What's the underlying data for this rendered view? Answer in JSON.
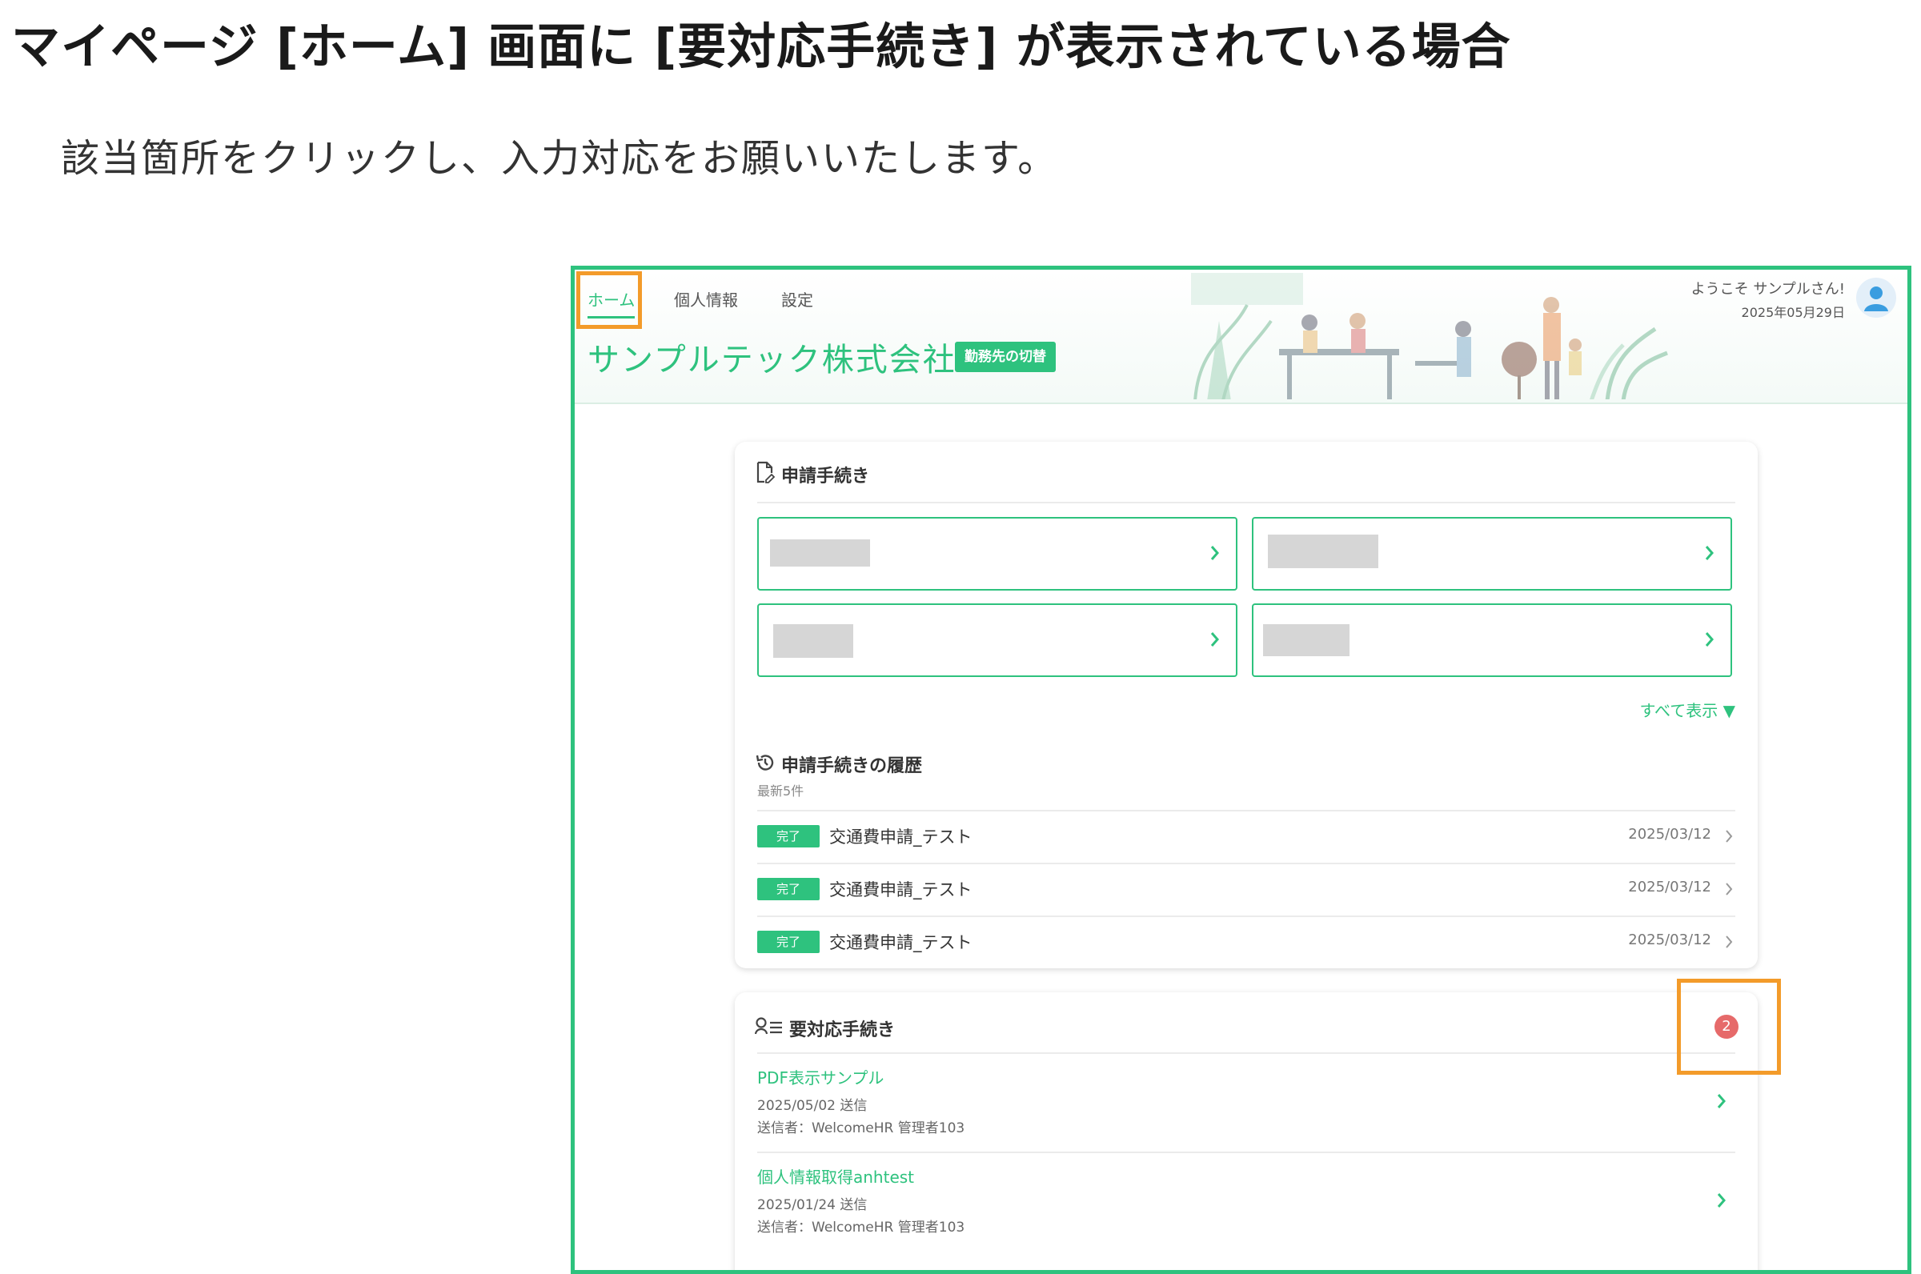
{
  "document": {
    "title": "マイページ [ホーム] 画面に [要対応手続き] が表示されている場合",
    "instruction": "該当箇所をクリックし、入力対応をお願いいたします。"
  },
  "nav": {
    "tabs": [
      {
        "label": "ホーム"
      },
      {
        "label": "個人情報"
      },
      {
        "label": "設定"
      }
    ]
  },
  "header": {
    "company": "サンプルテック株式会社",
    "switch_label": "勤務先の切替",
    "welcome": "ようこそ サンプルさん!",
    "date": "2025年05月29日"
  },
  "applications": {
    "title": "申請手続き",
    "show_all": "すべて表示 ▼"
  },
  "history": {
    "title": "申請手続きの履歴",
    "subtitle": "最新5件",
    "rows": [
      {
        "status": "完了",
        "name": "交通費申請_テスト",
        "date": "2025/03/12"
      },
      {
        "status": "完了",
        "name": "交通費申請_テスト",
        "date": "2025/03/12"
      },
      {
        "status": "完了",
        "name": "交通費申請_テスト",
        "date": "2025/03/12"
      }
    ]
  },
  "actions": {
    "title": "要対応手続き",
    "count": "2",
    "items": [
      {
        "name": "PDF表示サンプル",
        "date": "2025/05/02 送信",
        "sender": "送信者：WelcomeHR 管理者103"
      },
      {
        "name": "個人情報取得anhtest",
        "date": "2025/01/24 送信",
        "sender": "送信者：WelcomeHR 管理者103"
      }
    ]
  },
  "colors": {
    "accent": "#2ec27e",
    "highlight": "#f39b2a",
    "badge_red": "#e66a6a"
  }
}
